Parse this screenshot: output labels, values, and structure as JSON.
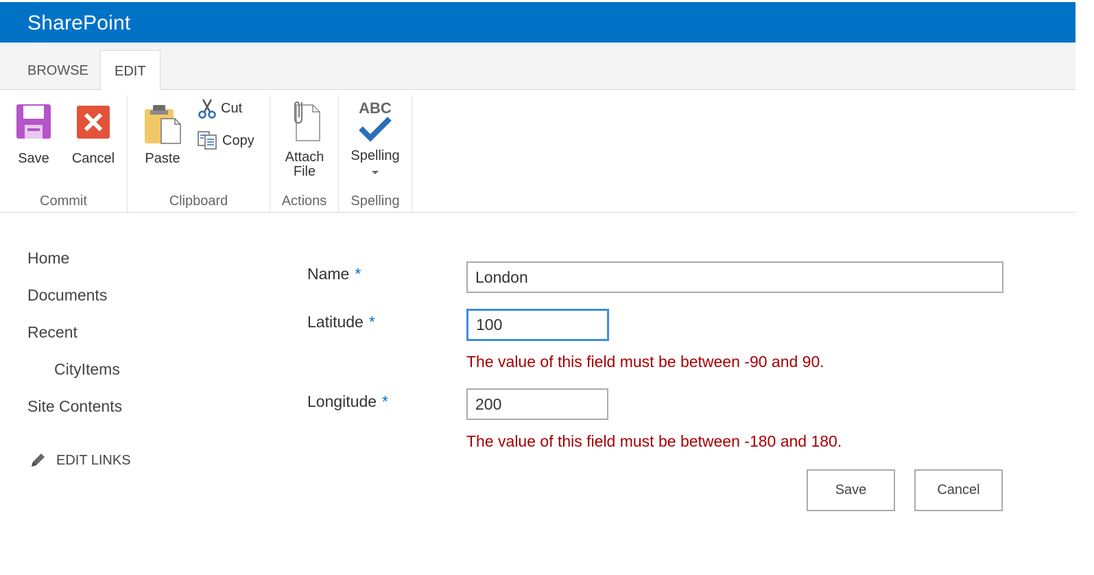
{
  "suitebar": {
    "brand": "SharePoint",
    "color": "#0072c6"
  },
  "tabs": {
    "browse": "BROWSE",
    "edit": "EDIT",
    "active": "EDIT"
  },
  "ribbon": {
    "commit": {
      "label": "Commit",
      "save": "Save",
      "cancel": "Cancel"
    },
    "clipboard": {
      "label": "Clipboard",
      "paste": "Paste",
      "cut": "Cut",
      "copy": "Copy"
    },
    "actions": {
      "label": "Actions",
      "attach_line1": "Attach",
      "attach_line2": "File"
    },
    "spelling": {
      "label": "Spelling",
      "button": "Spelling",
      "abc": "ABC"
    }
  },
  "nav": {
    "items": [
      "Home",
      "Documents",
      "Recent",
      "CityItems",
      "Site Contents"
    ],
    "edit_links": "EDIT LINKS"
  },
  "form": {
    "name": {
      "label": "Name",
      "required": "*",
      "value": "London"
    },
    "latitude": {
      "label": "Latitude",
      "required": "*",
      "value": "100",
      "error": "The value of this field must be between -90 and 90."
    },
    "longitude": {
      "label": "Longitude",
      "required": "*",
      "value": "200",
      "error": "The value of this field must be between -180 and 180."
    },
    "save": "Save",
    "cancel": "Cancel"
  },
  "colors": {
    "error": "#a80000",
    "required": "#0072c6",
    "focus": "#3c8de0"
  }
}
